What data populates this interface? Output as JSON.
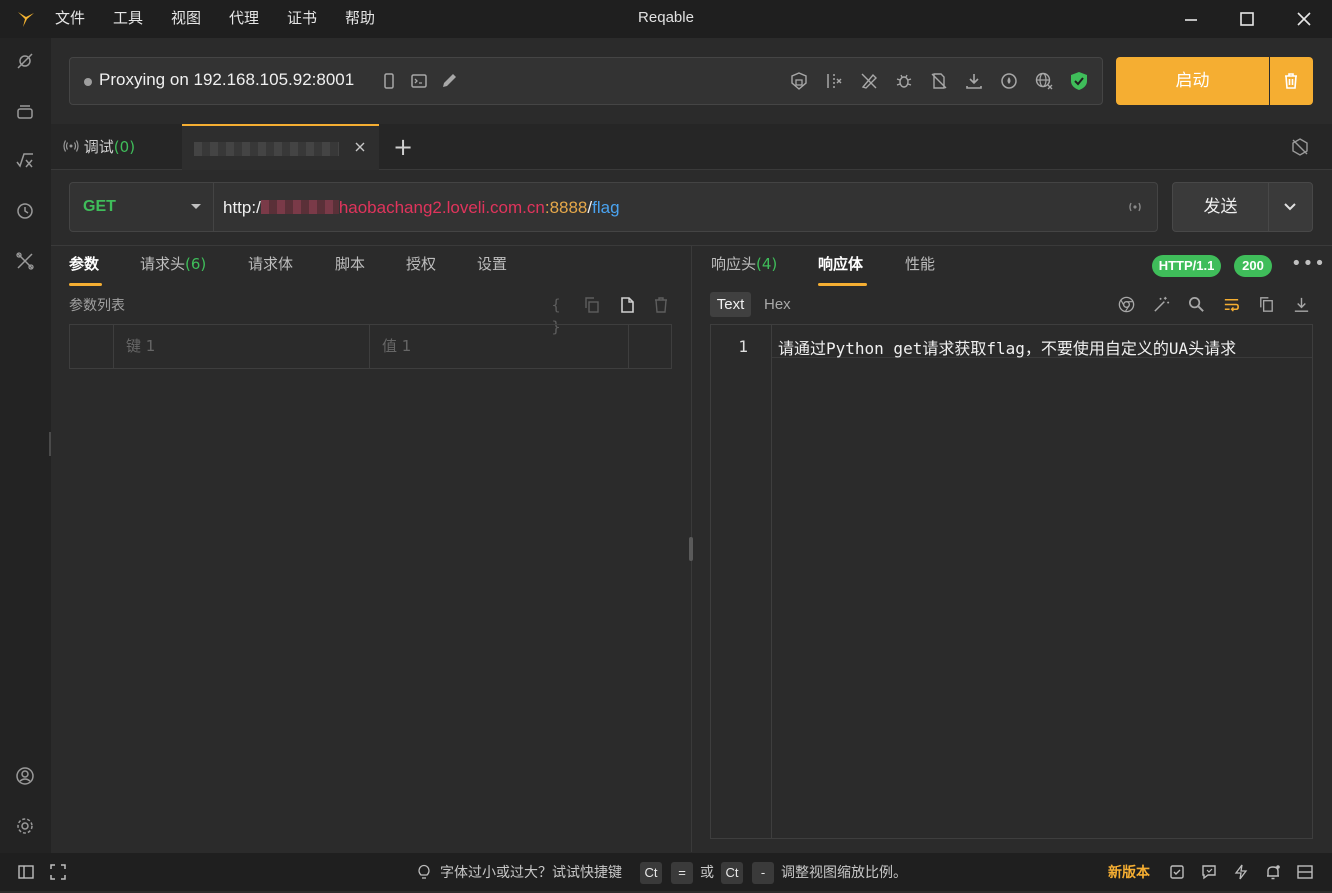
{
  "app": {
    "title": "Reqable"
  },
  "menu": [
    "文件",
    "工具",
    "视图",
    "代理",
    "证书",
    "帮助"
  ],
  "proxy": {
    "status_text": "Proxying on 192.168.105.92:8001",
    "start_label": "启动"
  },
  "tabs": {
    "debug_label": "调试",
    "debug_count": "(0)",
    "add_label": "+"
  },
  "request": {
    "method": "GET",
    "url_scheme": "http:/",
    "url_host": "haobachang2.loveli.com.cn",
    "url_port": ":8888",
    "url_slash": "/",
    "url_path": "flag",
    "send_label": "发送"
  },
  "request_tabs": [
    {
      "label": "参数",
      "count": ""
    },
    {
      "label": "请求头",
      "count": "(6)"
    },
    {
      "label": "请求体",
      "count": ""
    },
    {
      "label": "脚本",
      "count": ""
    },
    {
      "label": "授权",
      "count": ""
    },
    {
      "label": "设置",
      "count": ""
    }
  ],
  "params": {
    "label": "参数列表",
    "key_placeholder": "键 1",
    "value_placeholder": "值 1",
    "braces": "{ }"
  },
  "response_tabs": [
    {
      "label": "响应头",
      "count": "(4)"
    },
    {
      "label": "响应体",
      "count": ""
    },
    {
      "label": "性能",
      "count": ""
    }
  ],
  "response": {
    "protocol": "HTTP/1.1",
    "status_code": "200",
    "format_text": "Text",
    "format_hex": "Hex",
    "more": "•••",
    "line_number": "1",
    "body_line": "请通过Python get请求获取flag，不要使用自定义的UA头请求"
  },
  "status": {
    "hint_prefix": "字体过小或过大？试试快捷键",
    "key1": "Ct",
    "key1_b": "=",
    "or": "或",
    "key2": "Ct",
    "key2_b": "-",
    "hint_suffix": "调整视图缩放比例。",
    "new_version": "新版本"
  },
  "colors": {
    "accent": "#f5ae32",
    "green": "#3fbd5a",
    "host": "#e0345c",
    "port": "#e6a84a",
    "path": "#4aa3f0"
  }
}
